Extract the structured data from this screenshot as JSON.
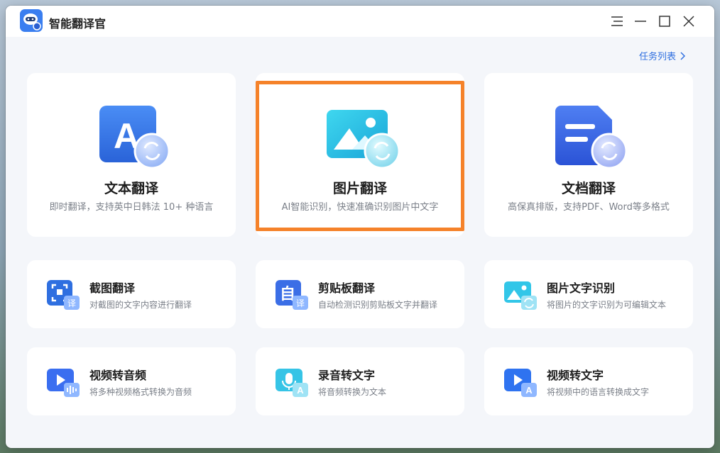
{
  "app": {
    "title": "智能翻译官"
  },
  "header": {
    "task_list_label": "任务列表"
  },
  "feature_cards": [
    {
      "title": "文本翻译",
      "description": "即时翻译，支持英中日韩法 10+ 种语言",
      "icon": "text-translate-icon"
    },
    {
      "title": "图片翻译",
      "description": "AI智能识别，快速准确识别图片中文字",
      "icon": "image-translate-icon"
    },
    {
      "title": "文档翻译",
      "description": "高保真排版，支持PDF、Word等多格式",
      "icon": "document-translate-icon"
    }
  ],
  "tool_cards": [
    {
      "title": "截图翻译",
      "description": "对截图的文字内容进行翻译",
      "icon": "screenshot-translate-icon"
    },
    {
      "title": "剪贴板翻译",
      "description": "自动检测识别剪贴板文字并翻译",
      "icon": "clipboard-translate-icon"
    },
    {
      "title": "图片文字识别",
      "description": "将图片的文字识别为可编辑文本",
      "icon": "image-ocr-icon"
    },
    {
      "title": "视频转音频",
      "description": "将多种视频格式转换为音频",
      "icon": "video-to-audio-icon"
    },
    {
      "title": "录音转文字",
      "description": "将音频转换为文本",
      "icon": "audio-to-text-icon"
    },
    {
      "title": "视频转文字",
      "description": "将视频中的语言转换成文字",
      "icon": "video-to-text-icon"
    }
  ],
  "colors": {
    "accent_blue": "#2f6fe0",
    "highlight_orange": "#f5822a"
  }
}
